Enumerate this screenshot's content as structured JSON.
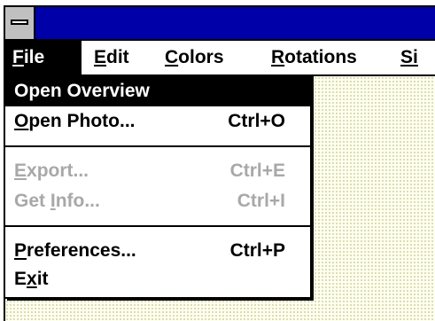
{
  "window": {
    "sysmenu_icon": "system-menu-icon"
  },
  "menubar": {
    "items": [
      {
        "pre": "",
        "mnemonic": "F",
        "post": "ile"
      },
      {
        "pre": "",
        "mnemonic": "E",
        "post": "dit"
      },
      {
        "pre": "",
        "mnemonic": "C",
        "post": "olors"
      },
      {
        "pre": "",
        "mnemonic": "R",
        "post": "otations"
      },
      {
        "pre": "",
        "mnemonic": "Si",
        "post": ""
      }
    ]
  },
  "file_menu": {
    "items": [
      {
        "pre": "Open Overview",
        "mnemonic": "",
        "post": "",
        "shortcut": "",
        "state": "selected"
      },
      {
        "pre": "",
        "mnemonic": "O",
        "post": "pen Photo...",
        "shortcut": "Ctrl+O",
        "state": "enabled"
      },
      {
        "pre": "",
        "mnemonic": "E",
        "post": "xport...",
        "shortcut": "Ctrl+E",
        "state": "disabled"
      },
      {
        "pre": "Get ",
        "mnemonic": "I",
        "post": "nfo...",
        "shortcut": "Ctrl+I",
        "state": "disabled"
      },
      {
        "pre": "",
        "mnemonic": "P",
        "post": "references...",
        "shortcut": "Ctrl+P",
        "state": "enabled"
      },
      {
        "pre": "E",
        "mnemonic": "x",
        "post": "it",
        "shortcut": "",
        "state": "enabled"
      }
    ]
  },
  "colors": {
    "title_bar": "#0000a8",
    "menu_selected_bg": "#000000",
    "menu_selected_fg": "#ffffff",
    "disabled_text": "#a8a8a8",
    "desktop_pattern": "#fffff0"
  }
}
